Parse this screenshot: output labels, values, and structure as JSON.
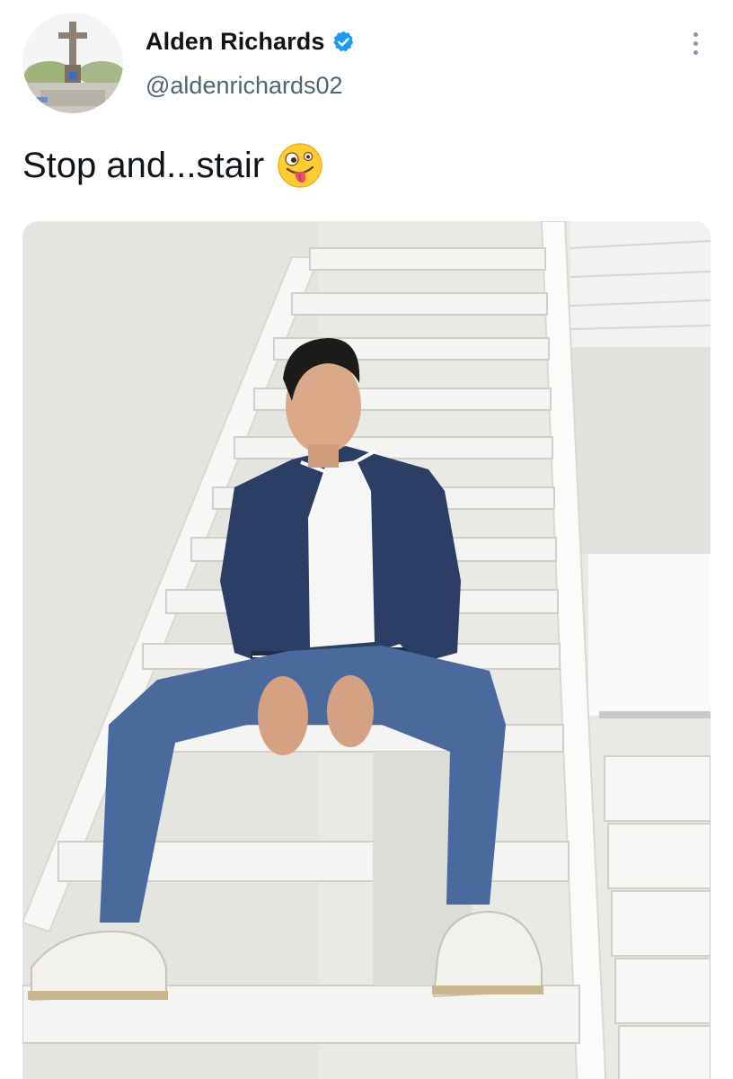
{
  "tweet": {
    "author": {
      "display_name": "Alden Richards",
      "handle": "@aldenrichards02",
      "verified": true,
      "avatar_icon": "profile-photo-cross-statue"
    },
    "text": "Stop and...stair",
    "emoji": "zany-face-emoji",
    "more_icon": "more-vertical-icon",
    "media": {
      "type": "photo",
      "alt": ""
    }
  },
  "colors": {
    "name": "#0f1419",
    "handle": "#536471",
    "verified": "#1d9bf0",
    "more_dots": "#8b98a5",
    "jacket": "#2c3e63",
    "jeans": "#4a6a9e",
    "stairs": "#f4f4f2",
    "wall": "#e9e9e6"
  }
}
